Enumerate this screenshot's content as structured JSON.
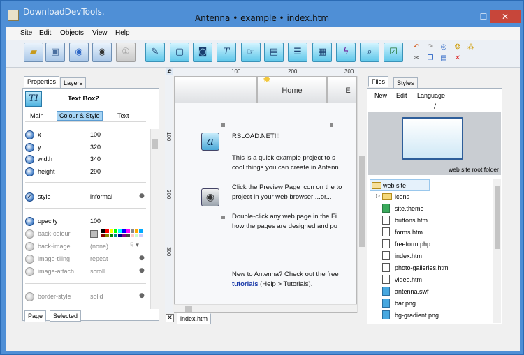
{
  "window": {
    "title": "Antenna • example • index.htm",
    "watermark": "DownloadDevTools.",
    "controls": {
      "minimize": "—",
      "maximize": "☐",
      "close": "✕"
    }
  },
  "menu": [
    "Site",
    "Edit",
    "Objects",
    "View",
    "Help"
  ],
  "toolbar_icons": [
    "open-folder-icon",
    "save-icon",
    "globe-icon",
    "preview-eye-icon",
    "info-icon",
    "edit-pen-icon",
    "rectangle-icon",
    "camera-icon",
    "text-icon",
    "link-cursor-icon",
    "gallery-icon",
    "form-icon",
    "image-icon",
    "flash-icon",
    "magnify-icon",
    "checkbox-icon"
  ],
  "left_panel": {
    "tabs": [
      "Properties",
      "Layers"
    ],
    "object_icon": "TI",
    "object_name": "Text Box2",
    "subtabs": [
      "Main",
      "Colour & Style",
      "Text"
    ],
    "properties": [
      {
        "name": "x",
        "value": "100",
        "enabled": true
      },
      {
        "name": "y",
        "value": "320",
        "enabled": true
      },
      {
        "name": "width",
        "value": "340",
        "enabled": true
      },
      {
        "name": "height",
        "value": "290",
        "enabled": true
      },
      {
        "name": "style",
        "value": "informal",
        "enabled": true
      },
      {
        "name": "opacity",
        "value": "100",
        "enabled": true
      },
      {
        "name": "back-colour",
        "value": "",
        "enabled": false
      },
      {
        "name": "back-image",
        "value": "(none)",
        "enabled": false
      },
      {
        "name": "image-tiling",
        "value": "repeat",
        "enabled": false
      },
      {
        "name": "image-attach",
        "value": "scroll",
        "enabled": false
      },
      {
        "name": "border-style",
        "value": "solid",
        "enabled": false
      }
    ],
    "bottom_tabs": [
      "Page",
      "Selected"
    ]
  },
  "ruler": {
    "top_labels": [
      "100",
      "200",
      "300"
    ],
    "left_labels": [
      "100",
      "200",
      "300"
    ]
  },
  "editor": {
    "nav_buttons": [
      "Home",
      "E"
    ],
    "heading": "RSLOAD.NET!!!",
    "para1": [
      "This is a quick example project to s",
      "cool things you can create in Antenn"
    ],
    "para2": [
      "Click the Preview Page icon on the to",
      "project in your web browser ...or..."
    ],
    "para3": [
      "Double-click any web page in the Fi",
      "how the pages are designed and pu"
    ],
    "para4_line1": "New to Antenna?  Check out the free",
    "para4_link": "tutorials",
    "para4_rest": " (Help > Tutorials).",
    "doc_tab": "index.htm"
  },
  "right_panel": {
    "tabs": [
      "Files",
      "Styles"
    ],
    "menu": [
      "New",
      "Edit",
      "Language"
    ],
    "path": "/",
    "preview_caption": "web site root folder",
    "root": "web site",
    "files": [
      {
        "name": "icons",
        "type": "folder"
      },
      {
        "name": "site.theme",
        "type": "theme"
      },
      {
        "name": "buttons.htm",
        "type": "page"
      },
      {
        "name": "forms.htm",
        "type": "page"
      },
      {
        "name": "freeform.php",
        "type": "page"
      },
      {
        "name": "index.htm",
        "type": "page"
      },
      {
        "name": "photo-galleries.htm",
        "type": "page"
      },
      {
        "name": "video.htm",
        "type": "page"
      },
      {
        "name": "antenna.swf",
        "type": "img"
      },
      {
        "name": "bar.png",
        "type": "img"
      },
      {
        "name": "bg-gradient.png",
        "type": "img"
      }
    ]
  }
}
